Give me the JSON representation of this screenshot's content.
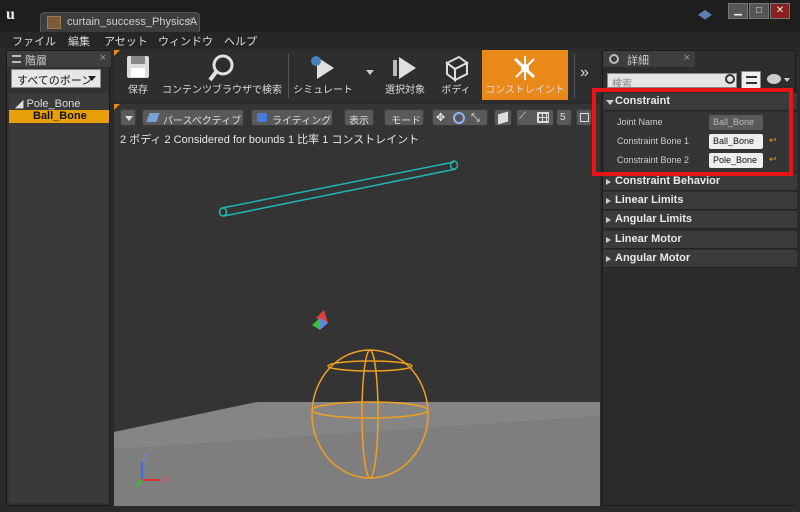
{
  "titlebar": {
    "tab_title": "curtain_success_PhysicsA",
    "minimize": "▁",
    "maximize": "□",
    "close": "✕"
  },
  "menu": [
    "ファイル",
    "編集",
    "アセット",
    "ウィンドウ",
    "ヘルプ"
  ],
  "hierarchy": {
    "tab_label": "階層",
    "filter_value": "すべてのボーン",
    "tree": [
      {
        "label": "◢ Pole_Bone",
        "selected": false
      },
      {
        "label": "Ball_Bone",
        "selected": true
      }
    ]
  },
  "toolbar": {
    "buttons": [
      {
        "label": "保存",
        "icon": "save-icon"
      },
      {
        "label": "コンテンツブラウザで検索",
        "icon": "magnifier-icon"
      },
      {
        "label": "シミュレート",
        "icon": "simulate-icon"
      },
      {
        "label": "選択対象",
        "icon": "play-selected-icon"
      },
      {
        "label": "ボディ",
        "icon": "body-icon"
      },
      {
        "label": "コンストレイント",
        "icon": "constraint-icon"
      }
    ],
    "more": "»"
  },
  "viewport": {
    "perspective": "パースペクティブ",
    "lighting": "ライティング",
    "show": "表示",
    "mode": "モード",
    "grid_value": "5",
    "stats": "2 ボディ 2 Considered for bounds 1 比率 1 コンストレイント",
    "axes": {
      "x": "X",
      "z": "Z"
    }
  },
  "details": {
    "tab_label": "詳細",
    "search_placeholder": "検索",
    "constraint_header": "Constraint",
    "props": [
      {
        "label": "Joint Name",
        "value": "Ball_Bone",
        "editable": false
      },
      {
        "label": "Constraint Bone 1",
        "value": "Ball_Bone",
        "editable": true
      },
      {
        "label": "Constraint Bone 2",
        "value": "Pole_Bone",
        "editable": true
      }
    ],
    "sections": [
      "Constraint Behavior",
      "Linear Limits",
      "Angular Limits",
      "Linear Motor",
      "Angular Motor"
    ]
  },
  "colors": {
    "accent": "#e8891a",
    "selection": "#e8a00a",
    "highlight_box": "#e8141a",
    "capsule": "#1fb5b0",
    "sphere": "#f0a020"
  }
}
